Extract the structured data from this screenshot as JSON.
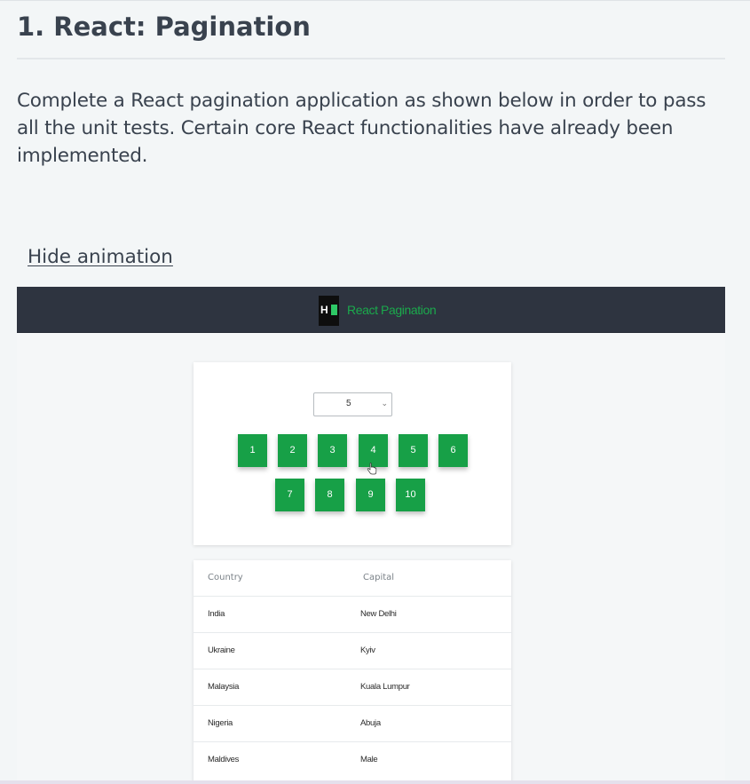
{
  "problem": {
    "title": "1. React: Pagination",
    "description": "Complete a React pagination application as shown below in order to pass all the unit tests. Certain core React functionalities have already been implemented.",
    "hide_animation_label": "Hide animation"
  },
  "demo": {
    "header": {
      "logo_text": "H",
      "title": "React Pagination"
    },
    "page_size_select": {
      "value": "5"
    },
    "pagination": {
      "pages": [
        "1",
        "2",
        "3",
        "4",
        "5",
        "6",
        "7",
        "8",
        "9",
        "10"
      ]
    },
    "table": {
      "headers": {
        "country": "Country",
        "capital": "Capital"
      },
      "rows": [
        {
          "country": "India",
          "capital": "New Delhi"
        },
        {
          "country": "Ukraine",
          "capital": "Kyiv"
        },
        {
          "country": "Malaysia",
          "capital": "Kuala Lumpur"
        },
        {
          "country": "Nigeria",
          "capital": "Abuja"
        },
        {
          "country": "Maldives",
          "capital": "Male"
        }
      ]
    }
  },
  "icons": {
    "select_chevron": "chevron-down-icon",
    "pointer": "hand-cursor-icon",
    "logo": "hackerrank-logo-icon"
  },
  "colors": {
    "page_button": "#17a047",
    "header_bg": "#2e3440",
    "header_title": "#1ba94c",
    "text": "#39424e"
  }
}
